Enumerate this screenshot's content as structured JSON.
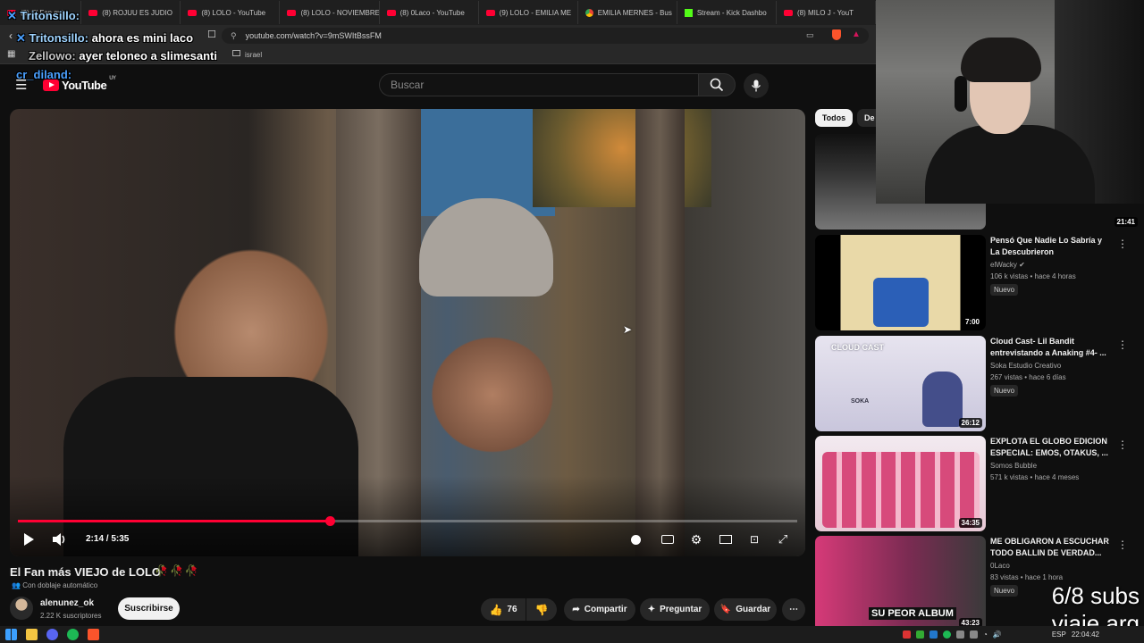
{
  "browser": {
    "tabs": [
      {
        "label": "(8) El Fan más",
        "icon": "youtube-icon"
      },
      {
        "label": "(8) ROJUU ES JUDIO",
        "icon": "youtube-icon"
      },
      {
        "label": "(8) LOLO - YouTube",
        "icon": "youtube-icon"
      },
      {
        "label": "(8) LOLO - NOVIEMBRE",
        "icon": "youtube-icon"
      },
      {
        "label": "(8) 0Laco - YouTube",
        "icon": "youtube-icon"
      },
      {
        "label": "(9) LOLO - EMILIA ME",
        "icon": "youtube-icon"
      },
      {
        "label": "EMILIA MERNES - Bus",
        "icon": "chrome-icon"
      },
      {
        "label": "Stream - Kick Dashbo",
        "icon": "kick-icon"
      },
      {
        "label": "(8) MILO J - YouT",
        "icon": "youtube-icon"
      }
    ],
    "url": "youtube.com/watch?v=9mSWItBssFM",
    "bookmark": "israel"
  },
  "youtube": {
    "logo_text": "YouTube",
    "logo_country": "UY",
    "search_placeholder": "Buscar"
  },
  "player": {
    "current_time": "2:14 / 5:35",
    "progress_fraction": 0.3999,
    "accent": "#ff0033"
  },
  "video": {
    "title": "El Fan más VIEJO de LOLO",
    "title_emojis": "🥀🥀🥀",
    "dub_label": "Con doblaje automático",
    "channel": "alenunez_ok",
    "subscribers": "2.22 K suscriptores",
    "subscribe_label": "Suscribirse",
    "likes": "76",
    "share_label": "Compartir",
    "ask_label": "Preguntar",
    "save_label": "Guardar"
  },
  "sidebar": {
    "chips": [
      "Todos",
      "De"
    ],
    "recommendations": [
      {
        "title": "",
        "channel": "",
        "meta": "",
        "badge": "",
        "duration": "21:41"
      },
      {
        "title": "Pensó Que Nadie Lo Sabría y La Descubrieron",
        "channel": "elWacky",
        "meta": "106 k vistas • hace 4 horas",
        "badge": "Nuevo",
        "duration": "7:00"
      },
      {
        "title": "Cloud Cast- Lil Bandit entrevistando a Anaking #4- ...",
        "channel": "Soka Estudio Creativo",
        "meta": "267 vistas • hace 6 días",
        "badge": "Nuevo",
        "duration": "26:12"
      },
      {
        "title": "EXPLOTA EL GLOBO EDICION ESPECIAL: EMOS, OTAKUS, ...",
        "channel": "Somos Bubble",
        "meta": "571 k vistas • hace 4 meses",
        "badge": "",
        "duration": "34:35"
      },
      {
        "title": "ME OBLIGARON A ESCUCHAR TODO BALLIN DE VERDAD...",
        "channel": "0Laco",
        "meta": "83 vistas • hace 1 hora",
        "badge": "Nuevo",
        "duration": "43:23"
      }
    ]
  },
  "stream_overlay": {
    "chat": [
      {
        "user": "Tritonsillo:",
        "message": ""
      },
      {
        "user": "Tritonsillo:",
        "message": "ahora es mini laco"
      },
      {
        "user": "Zellowo:",
        "message": "ayer teloneo a slimesanti"
      },
      {
        "user": "cr_diland:",
        "message": ""
      }
    ],
    "sub_goal": "6/8 subs",
    "caption": "viaje arg"
  },
  "thumbnail_text": {
    "cloud_cast": "CLOUD CAST",
    "soka": "SOKA",
    "su_peor_album": "SU PEOR ALBUM"
  },
  "taskbar": {
    "language": "ESP",
    "clock": "22:04:42"
  }
}
